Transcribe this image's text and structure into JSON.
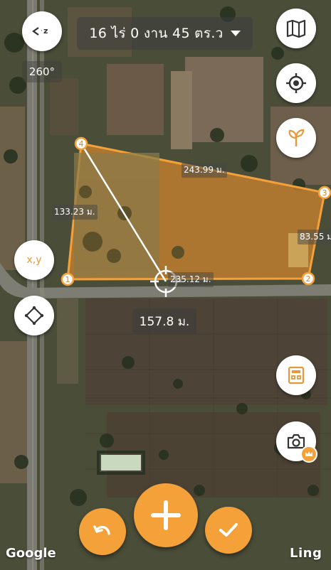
{
  "area_display": "16 ไร่ 0 งาน 45 ตร.ว",
  "heading": "260°",
  "segments": {
    "s12": "235.12 ม.",
    "s23": "83.55 ม.",
    "s34": "243.99 ม.",
    "s41": "133.23 ม."
  },
  "vertices": [
    "1",
    "2",
    "3",
    "4"
  ],
  "measure_distance": "157.8 ม.",
  "coord_button": "x,y",
  "attribution": "Google",
  "brand": "Ling",
  "colors": {
    "accent": "#f5a13a",
    "polygon_fill": "#c8812e",
    "polygon_stroke": "#f5a13a",
    "measure_line": "#ffffff"
  },
  "icons": {
    "compass": "angle-icon",
    "map_layers": "map-icon",
    "locate": "locate-icon",
    "plant": "sprout-icon",
    "coordinates": "xy-icon",
    "shape": "diamond-icon",
    "calculator": "calculator-icon",
    "camera": "camera-icon",
    "premium": "crown-icon",
    "undo": "undo-icon",
    "add": "plus-icon",
    "confirm": "check-icon"
  }
}
